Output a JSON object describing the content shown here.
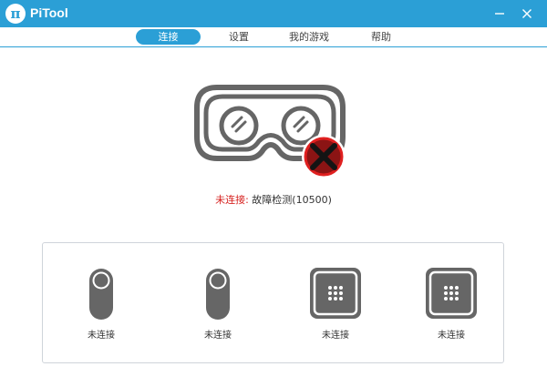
{
  "app": {
    "logo_glyph": "π",
    "title": "PiTool"
  },
  "window": {
    "minimize_icon": "minimize-icon",
    "close_icon": "close-icon"
  },
  "nav": {
    "tabs": [
      {
        "label": "连接",
        "active": true
      },
      {
        "label": "设置",
        "active": false
      },
      {
        "label": "我的游戏",
        "active": false
      },
      {
        "label": "帮助",
        "active": false
      }
    ]
  },
  "status": {
    "headset_icon": "vr-headset-icon",
    "badge_icon": "disconnected-x-icon",
    "error_label": "未连接:",
    "message": " 故障检测(10500)"
  },
  "devices": [
    {
      "icon": "controller-icon",
      "label": "未连接"
    },
    {
      "icon": "controller-icon",
      "label": "未连接"
    },
    {
      "icon": "base-station-icon",
      "label": "未连接"
    },
    {
      "icon": "base-station-icon",
      "label": "未连接"
    }
  ],
  "colors": {
    "accent": "#2b9fd6",
    "icon_gray": "#666666",
    "error_red": "#d6201e",
    "badge_dark_red": "#8b1414"
  }
}
